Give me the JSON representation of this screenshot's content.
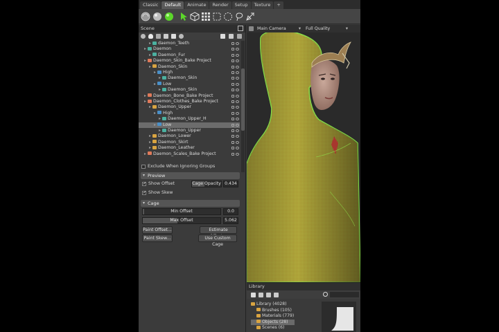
{
  "tabs": [
    {
      "label": "Classic",
      "active": false
    },
    {
      "label": "Default",
      "active": true
    },
    {
      "label": "Animate",
      "active": false
    },
    {
      "label": "Render",
      "active": false
    },
    {
      "label": "Setup",
      "active": false
    },
    {
      "label": "Texture",
      "active": false
    },
    {
      "label": "+",
      "active": false
    }
  ],
  "toolbar": {
    "icons": [
      "sphere-icon",
      "sphere-shaded-icon",
      "sphere-green-icon",
      "pointer-icon",
      "cube-icon",
      "grid-icon",
      "select-rect-icon",
      "select-circle-icon",
      "lasso-icon",
      "freehand-icon"
    ],
    "accent": "#5cd62a"
  },
  "scene": {
    "title": "Scene",
    "items": [
      {
        "label": "daemon_Teeth",
        "depth": 1,
        "icon": "obj",
        "sel": false
      },
      {
        "label": "Daemon",
        "depth": 0,
        "icon": "obj",
        "sel": false
      },
      {
        "label": "Daemon_Fur",
        "depth": 1,
        "icon": "obj",
        "sel": false
      },
      {
        "label": "Daemon_Skin_Bake Project",
        "depth": 0,
        "icon": "bake",
        "sel": false
      },
      {
        "label": "Daemon_Skin",
        "depth": 1,
        "icon": "folder",
        "sel": false
      },
      {
        "label": "High",
        "depth": 2,
        "icon": "mesh",
        "sel": false
      },
      {
        "label": "Daemon_Skin",
        "depth": 3,
        "icon": "obj",
        "sel": false
      },
      {
        "label": "Low",
        "depth": 2,
        "icon": "mesh",
        "sel": false
      },
      {
        "label": "Daemon_Skin",
        "depth": 3,
        "icon": "obj",
        "sel": false
      },
      {
        "label": "Daemon_Bone_Bake Project",
        "depth": 0,
        "icon": "bake",
        "sel": false
      },
      {
        "label": "Daemon_Clothes_Bake Project",
        "depth": 0,
        "icon": "bake",
        "sel": false
      },
      {
        "label": "Daemon_Upper",
        "depth": 1,
        "icon": "folder",
        "sel": false
      },
      {
        "label": "High",
        "depth": 2,
        "icon": "mesh",
        "sel": false
      },
      {
        "label": "Daemon_Upper_H",
        "depth": 3,
        "icon": "obj",
        "sel": false
      },
      {
        "label": "Low",
        "depth": 2,
        "icon": "mesh",
        "sel": true
      },
      {
        "label": "Daemon_Upper",
        "depth": 3,
        "icon": "obj",
        "sel": false
      },
      {
        "label": "Daemon_Lower",
        "depth": 1,
        "icon": "folder",
        "sel": false
      },
      {
        "label": "Daemon_Skirt",
        "depth": 1,
        "icon": "folder",
        "sel": false
      },
      {
        "label": "Daemon_Leather",
        "depth": 1,
        "icon": "folder",
        "sel": false
      },
      {
        "label": "Daemon_Scales_Bake Project",
        "depth": 0,
        "icon": "bake",
        "sel": false
      }
    ]
  },
  "props": {
    "exclude_label": "Exclude When Ignoring Groups",
    "preview": {
      "title": "Preview",
      "show_offset": "Show Offset",
      "cage_opacity_label": "Cage Opacity",
      "cage_opacity_value": "0.434",
      "show_skew": "Show Skew"
    },
    "cage": {
      "title": "Cage",
      "min_offset_label": "Min Offset",
      "min_offset_value": "0.0",
      "max_offset_label": "Max Offset",
      "max_offset_value": "5.062",
      "paint_offset": "Paint Offset...",
      "estimate_offset": "Estimate Offset...",
      "paint_skew": "Paint Skew...",
      "use_custom_cage": "Use Custom Cage"
    }
  },
  "viewport": {
    "camera": "Main Camera",
    "quality": "Full Quality",
    "cage_color": "#8ee04a"
  },
  "library": {
    "title": "Library",
    "items": [
      {
        "label": "Library (4028)",
        "depth": 0,
        "sel": false
      },
      {
        "label": "Brushes (105)",
        "depth": 1,
        "sel": false
      },
      {
        "label": "Materials (779)",
        "depth": 1,
        "sel": false
      },
      {
        "label": "Objects (28)",
        "depth": 1,
        "sel": true
      },
      {
        "label": "Scenes (6)",
        "depth": 1,
        "sel": false
      }
    ]
  }
}
